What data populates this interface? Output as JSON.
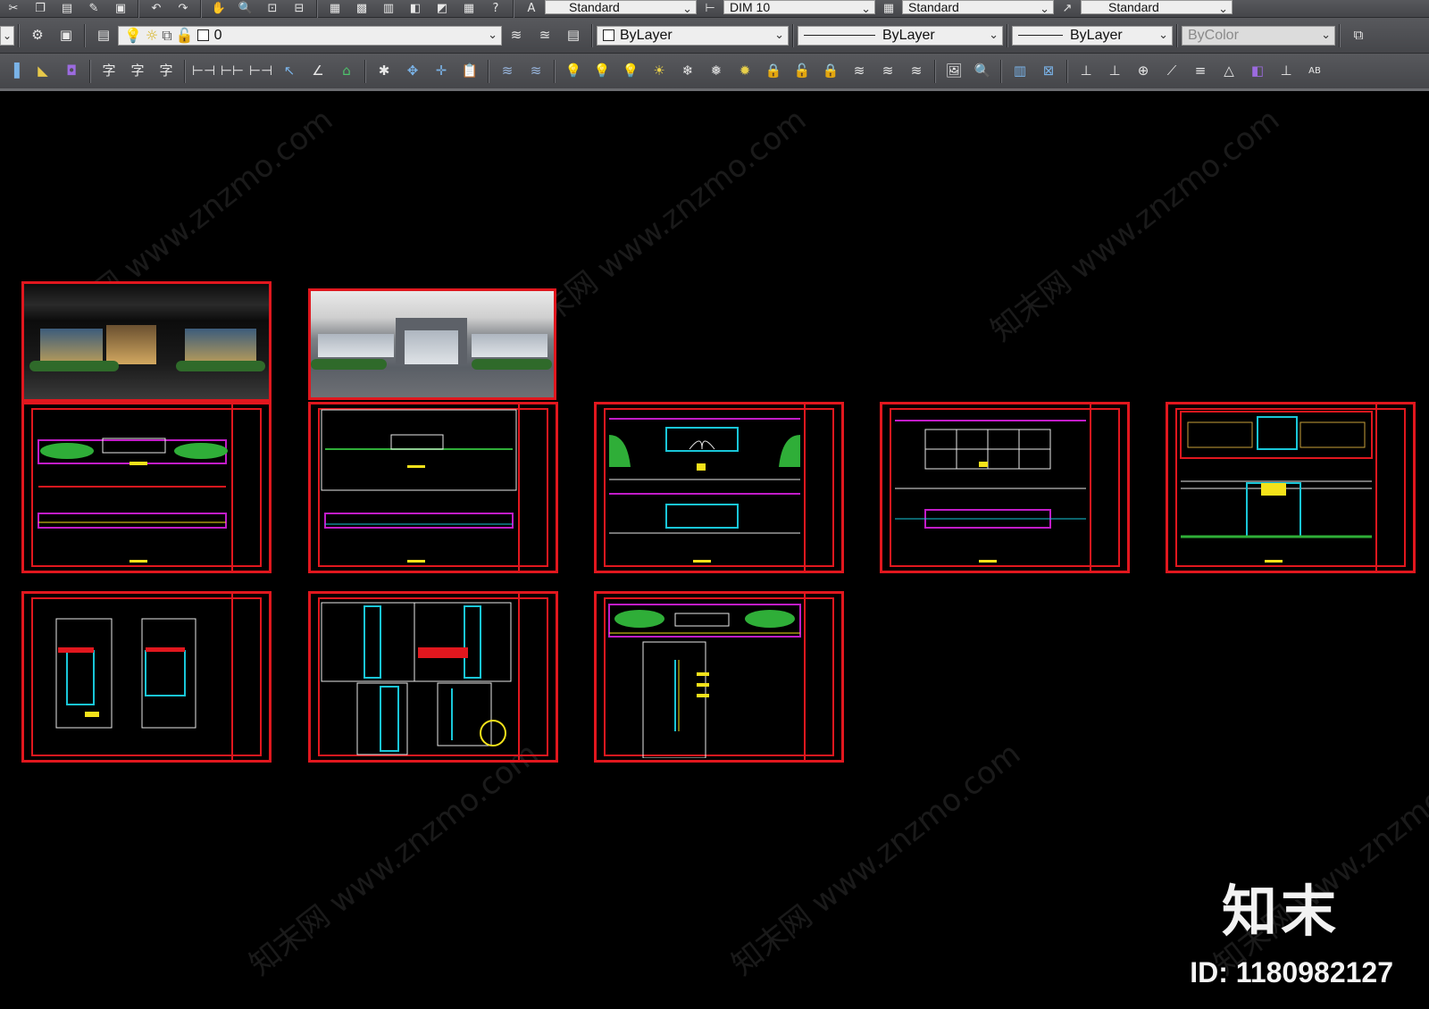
{
  "toolbar_top": {
    "text_style": "Standard",
    "dim_style": "DIM 10",
    "table_style": "Standard",
    "mleader_style": "Standard"
  },
  "toolbar_layers": {
    "current_layer": "0",
    "color": "ByLayer",
    "linetype": "ByLayer",
    "lineweight": "ByLayer",
    "plotstyle": "ByColor"
  },
  "watermark": {
    "logo": "知末",
    "id_label": "ID: 1180982127",
    "diagonal_text": "知末网 www.znzmo.com"
  },
  "colors": {
    "frame_red": "#e1171e",
    "cad_magenta": "#c21cc8",
    "cad_green": "#2fae38",
    "cad_yellow": "#f4e21a",
    "cad_cyan": "#19c6d8"
  }
}
